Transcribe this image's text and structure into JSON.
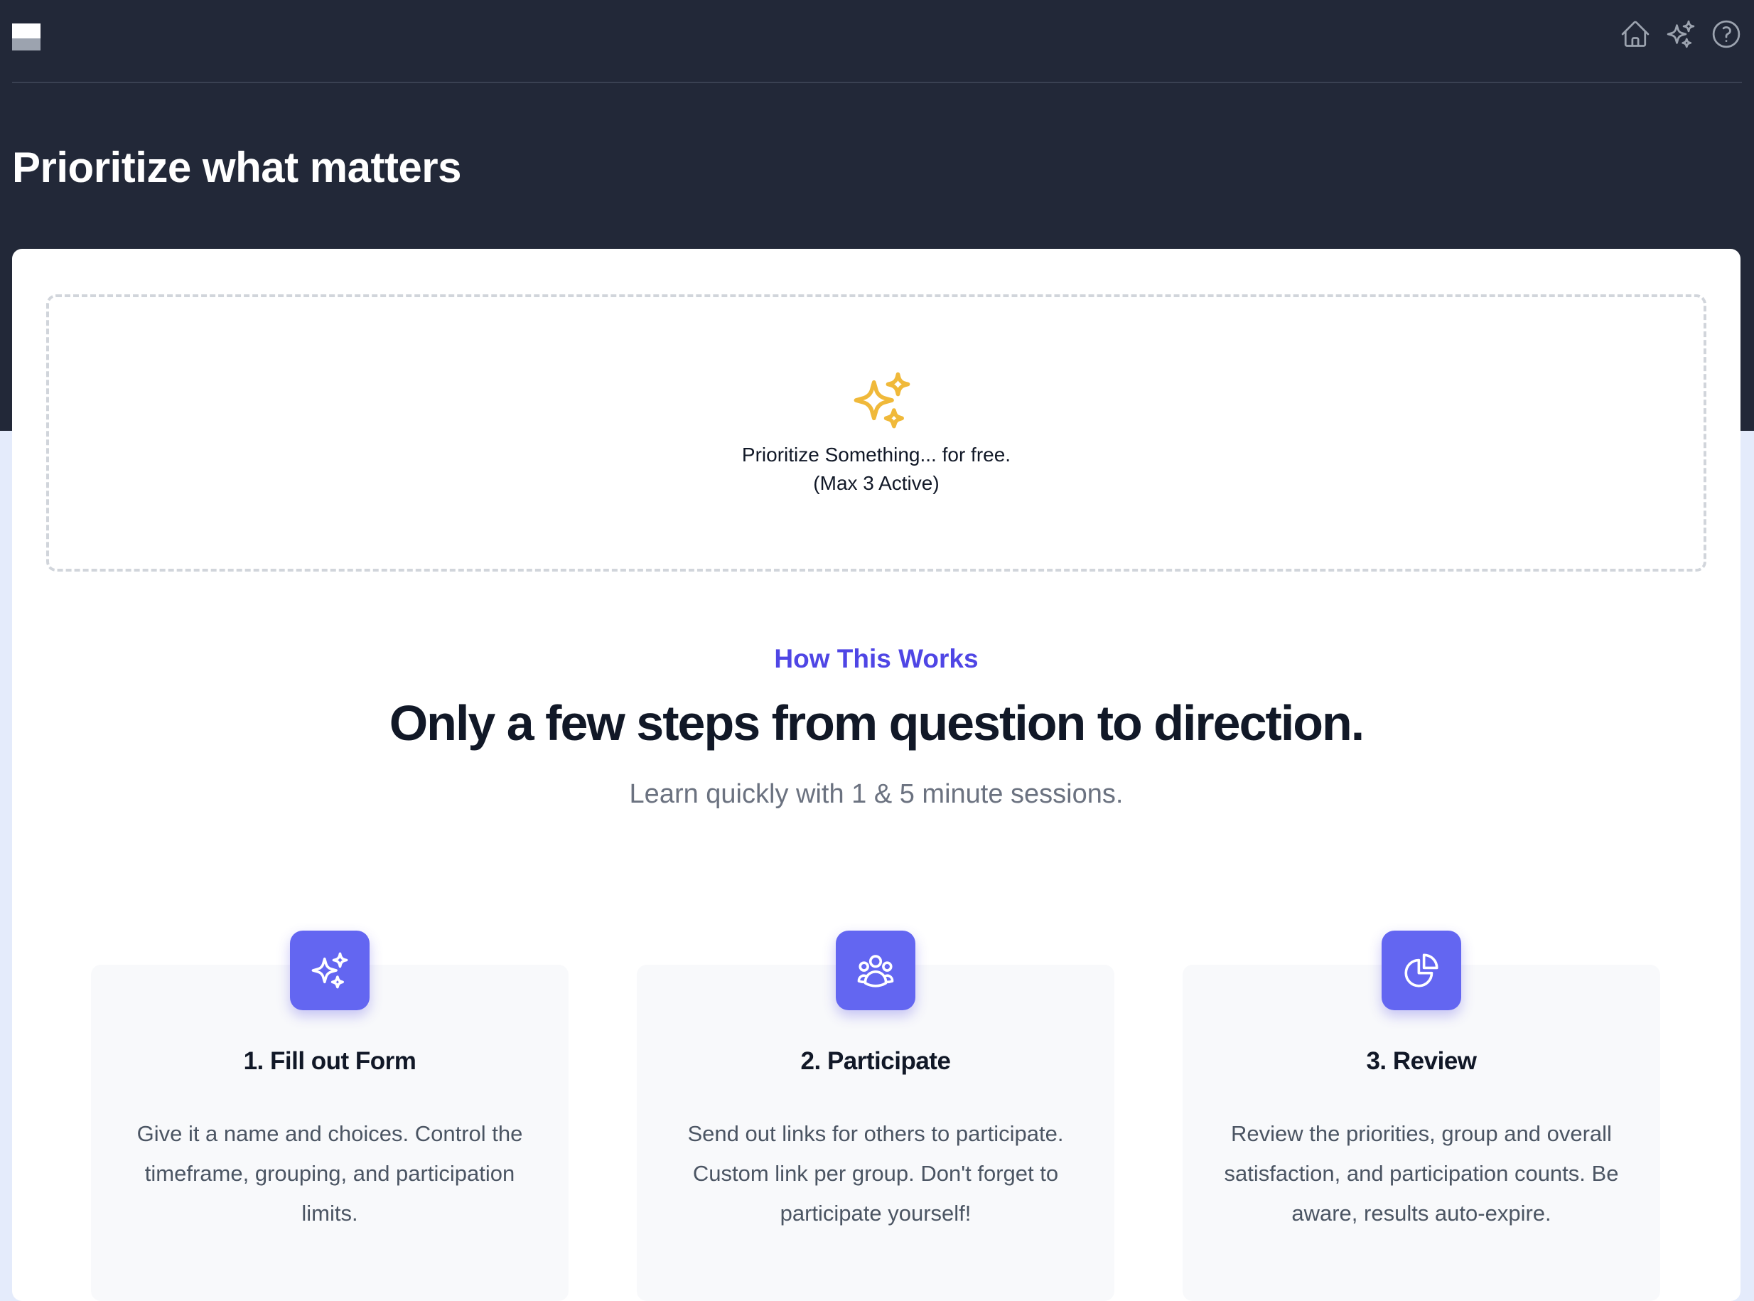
{
  "app": {
    "logo_icon": "logo-mark",
    "nav_icons": [
      "home-icon",
      "sparkles-icon",
      "help-circle-icon"
    ]
  },
  "header": {
    "title": "Prioritize what matters"
  },
  "new_prioritization": {
    "icon": "sparkles-icon",
    "line1": "Prioritize Something... for free.",
    "line2": "(Max 3 Active)"
  },
  "how_it_works": {
    "eyebrow": "How This Works",
    "headline": "Only a few steps from question to direction.",
    "subline": "Learn quickly with 1 & 5 minute sessions."
  },
  "steps": [
    {
      "icon": "sparkles-icon",
      "title": "1. Fill out Form",
      "text": "Give it a name and choices. Control the timeframe, grouping, and participation limits."
    },
    {
      "icon": "user-group-icon",
      "title": "2. Participate",
      "text": "Send out links for others to participate. Custom link per group. Don't forget to participate yourself!"
    },
    {
      "icon": "chart-pie-icon",
      "title": "3. Review",
      "text": "Review the priorities, group and overall satisfaction, and participation counts. Be aware, results auto-expire."
    }
  ],
  "colors": {
    "header_bg": "#222838",
    "page_bg": "#e4ebfb",
    "accent": "#6366f1",
    "eyebrow": "#4f46e5",
    "sparkle_yellow": "#f0b93a"
  }
}
